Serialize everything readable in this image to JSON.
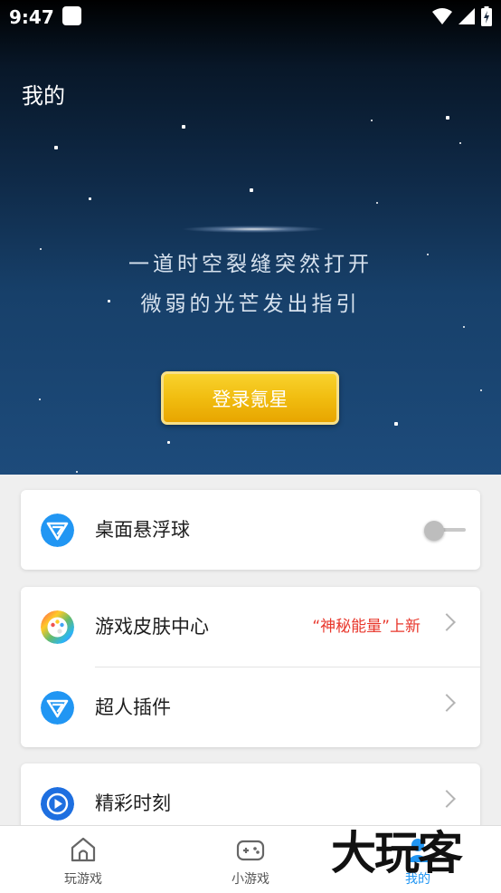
{
  "status_bar": {
    "time": "9:47"
  },
  "header": {
    "title": "我的",
    "tagline_1": "一道时空裂缝突然打开",
    "tagline_2": "微弱的光芒发出指引",
    "login_button": "登录氪星"
  },
  "cards": {
    "floating_ball": {
      "label": "桌面悬浮球",
      "toggle_on": false
    },
    "skin_center": {
      "label": "游戏皮肤中心",
      "promo": "“神秘能量”上新"
    },
    "superman_plugin": {
      "label": "超人插件"
    },
    "highlights": {
      "label": "精彩时刻"
    }
  },
  "bottom_nav": {
    "items": [
      {
        "label": "玩游戏",
        "icon": "home-icon"
      },
      {
        "label": "小游戏",
        "icon": "gamepad-icon"
      },
      {
        "label": "我的",
        "icon": "profile-icon",
        "active": true
      }
    ]
  },
  "watermark": "大玩客",
  "colors": {
    "accent": "#2196f3",
    "promo_red": "#e8372c",
    "login_gold": "#f1bd10",
    "hero_top": "#000000",
    "hero_bottom": "#1d4b7b"
  }
}
